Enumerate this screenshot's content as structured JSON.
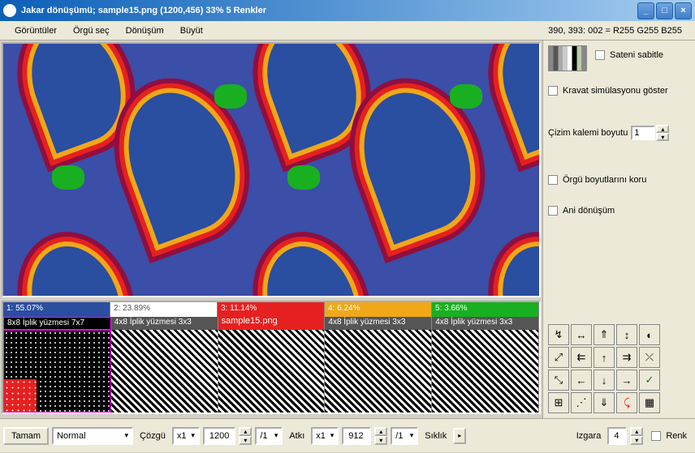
{
  "title": "Jakar dönüşümü; sample15.png (1200,456) 33% 5 Renkler",
  "menu": [
    "Görüntüler",
    "Örgü seç",
    "Dönüşüm",
    "Büyüt"
  ],
  "coords": "390, 393: 002 = R255 G255 B255",
  "right": {
    "fix_satin": "Sateni sabitle",
    "show_tie": "Kravat simülasyonu göster",
    "pen_label": "Çizim kalemi boyutu",
    "pen_value": "1",
    "keep_size": "Örgü boyutlarını koru",
    "instant": "Ani dönüşüm"
  },
  "colors": [
    {
      "idx": "1: 55.07%",
      "bg": "#2a4ea0",
      "label": "8x8 İplik yüzmesi 7x7",
      "fg": "#fff"
    },
    {
      "idx": "2: 23.89%",
      "bg": "#ffffff",
      "label": "4x8 İplik yüzmesi 3x3",
      "fg": "#555"
    },
    {
      "idx": "3: 11.14%",
      "bg": "#e62020",
      "label": "sample15.png",
      "fg": "#fff",
      "label2": "4x8 İplik yüzmesi 3x3"
    },
    {
      "idx": "4: 6.24%",
      "bg": "#f0a818",
      "label": "4x8 İplik yüzmesi 3x3",
      "fg": "#fff"
    },
    {
      "idx": "5: 3.66%",
      "bg": "#18b020",
      "label": "4x8 İplik yüzmesi 3x3",
      "fg": "#fff"
    }
  ],
  "bottom": {
    "ok": "Tamam",
    "mode": "Normal",
    "warp": "Çözgü",
    "warp_x": "x1",
    "warp_n": "1200",
    "warp_d": "/1",
    "weft": "Atkı",
    "weft_x": "x1",
    "weft_n": "912",
    "weft_d": "/1",
    "cycle": "Sıklık",
    "grid": "Izgara",
    "grid_n": "4",
    "color": "Renk"
  },
  "tools": [
    "↯",
    "↔",
    "⇑",
    "↕",
    "◐",
    "⤢",
    "⇇",
    "↑",
    "⇉",
    "⤫",
    "⤡",
    "←",
    "↓",
    "→",
    "✓",
    "⊞",
    "⋰",
    "⇓",
    "⤹",
    "▦"
  ]
}
